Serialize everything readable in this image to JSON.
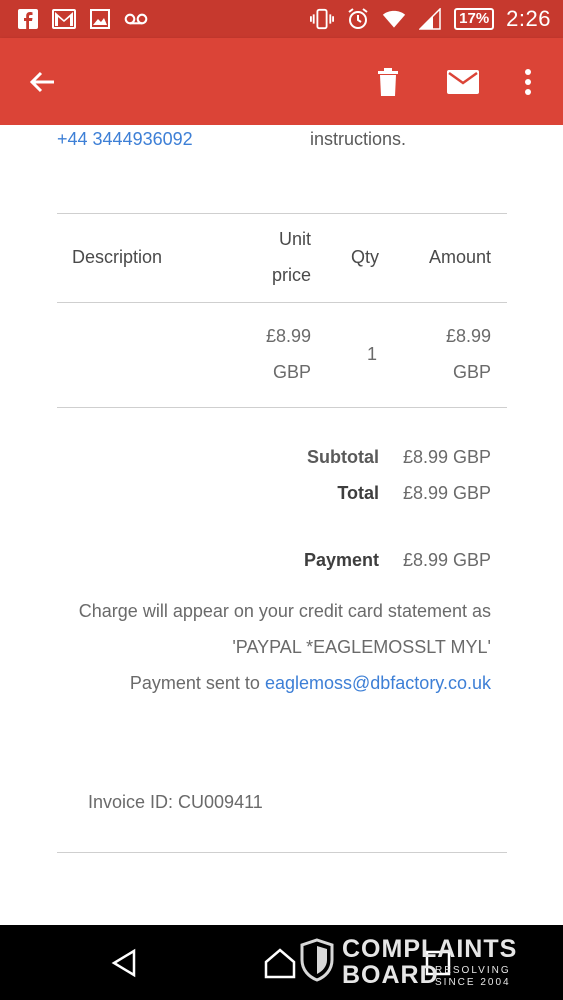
{
  "status_bar": {
    "battery": "17%",
    "time": "2:26",
    "notification_icons": [
      "facebook-icon",
      "gmail-icon",
      "image-icon",
      "voicemail-icon"
    ],
    "system_icons": [
      "vibrate-icon",
      "alarm-icon",
      "wifi-icon",
      "signal-icon",
      "battery-icon"
    ]
  },
  "app_bar": {
    "actions": [
      "back-arrow-icon",
      "delete-icon",
      "mark-unread-icon",
      "more-vert-icon"
    ]
  },
  "email": {
    "phone": "+44 3444936092",
    "instructions_fragment": "instructions.",
    "table": {
      "headers": {
        "description": "Description",
        "unit_price_line1": "Unit",
        "unit_price_line2": "price",
        "qty": "Qty",
        "amount": "Amount"
      },
      "row": {
        "description": "",
        "unit_price_line1": "£8.99",
        "unit_price_line2": "GBP",
        "qty": "1",
        "amount_line1": "£8.99",
        "amount_line2": "GBP"
      }
    },
    "subtotal_label": "Subtotal",
    "subtotal_value": "£8.99 GBP",
    "total_label": "Total",
    "total_value": "£8.99 GBP",
    "payment_label": "Payment",
    "payment_value": "£8.99 GBP",
    "statement_line": "Charge will appear on your credit card statement as",
    "statement_descriptor": "'PAYPAL *EAGLEMOSSLT MYL'",
    "payment_sent_prefix": "Payment sent to",
    "payment_sent_email": "eaglemoss@dbfactory.co.uk",
    "invoice_id": "Invoice ID: CU009411"
  },
  "watermark": {
    "line1": "COMPLAINTS",
    "line2": "BOARD",
    "tagline1": "RESOLVING",
    "tagline2": "SINCE 2004"
  },
  "colors": {
    "status_bar": "#c6392e",
    "app_bar": "#db4437",
    "link": "#3d7fd6"
  }
}
